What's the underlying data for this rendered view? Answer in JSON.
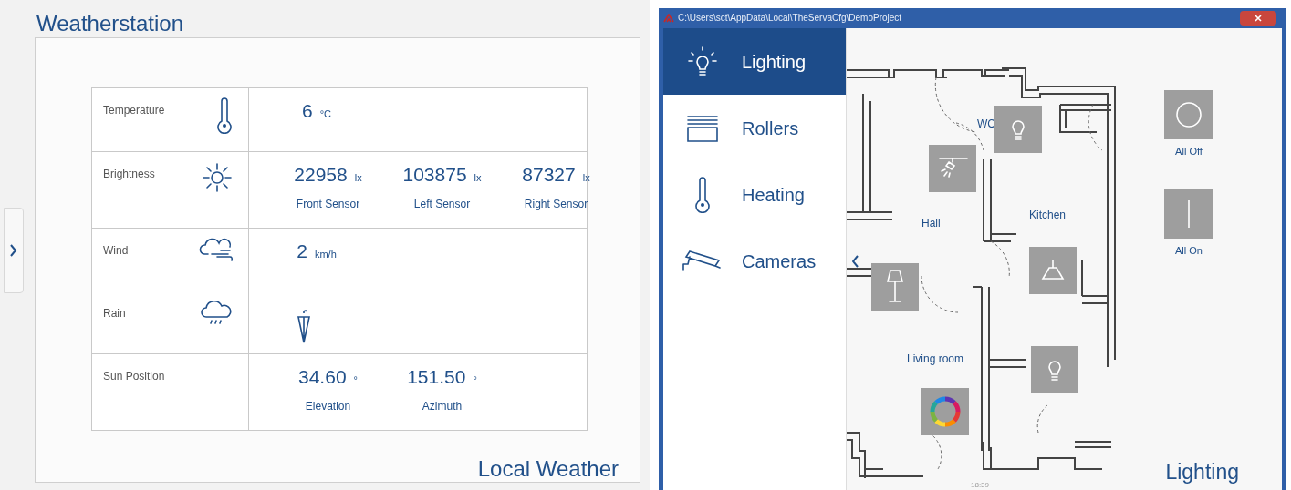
{
  "weather": {
    "title": "Weatherstation",
    "footer": "Local Weather",
    "rows": [
      {
        "kind": "temperature",
        "label": "Temperature",
        "readings": [
          {
            "value": "6",
            "unit": "°C"
          }
        ]
      },
      {
        "kind": "brightness",
        "label": "Brightness",
        "readings": [
          {
            "value": "22958",
            "unit": "lx",
            "caption": "Front Sensor"
          },
          {
            "value": "103875",
            "unit": "lx",
            "caption": "Left Sensor"
          },
          {
            "value": "87327",
            "unit": "lx",
            "caption": "Right Sensor"
          }
        ]
      },
      {
        "kind": "wind",
        "label": "Wind",
        "readings": [
          {
            "value": "2",
            "unit": "km/h"
          }
        ]
      },
      {
        "kind": "rain",
        "label": "Rain",
        "raining": false,
        "readings": []
      },
      {
        "kind": "sun",
        "label": "Sun Position",
        "readings": [
          {
            "value": "34.60",
            "unit": "°",
            "caption": "Elevation"
          },
          {
            "value": "151.50",
            "unit": "°",
            "caption": "Azimuth"
          }
        ]
      }
    ]
  },
  "app": {
    "title": "C:\\Users\\sct\\AppData\\Local\\TheServaCfg\\DemoProject",
    "menu": [
      {
        "kind": "lighting",
        "label": "Lighting",
        "selected": true
      },
      {
        "kind": "rollers",
        "label": "Rollers",
        "selected": false
      },
      {
        "kind": "heating",
        "label": "Heating",
        "selected": false
      },
      {
        "kind": "cameras",
        "label": "Cameras",
        "selected": false
      }
    ],
    "rooms": [
      "WC",
      "Hall",
      "Kitchen",
      "Living room"
    ],
    "devices": [
      {
        "kind": "bulb"
      },
      {
        "kind": "spot"
      },
      {
        "kind": "floor-lamp"
      },
      {
        "kind": "pendant"
      },
      {
        "kind": "bulb"
      },
      {
        "kind": "color"
      }
    ],
    "buttons": [
      {
        "kind": "off",
        "label": "All Off"
      },
      {
        "kind": "on",
        "label": "All On"
      }
    ],
    "footer": "Lighting",
    "time": "18:39"
  }
}
